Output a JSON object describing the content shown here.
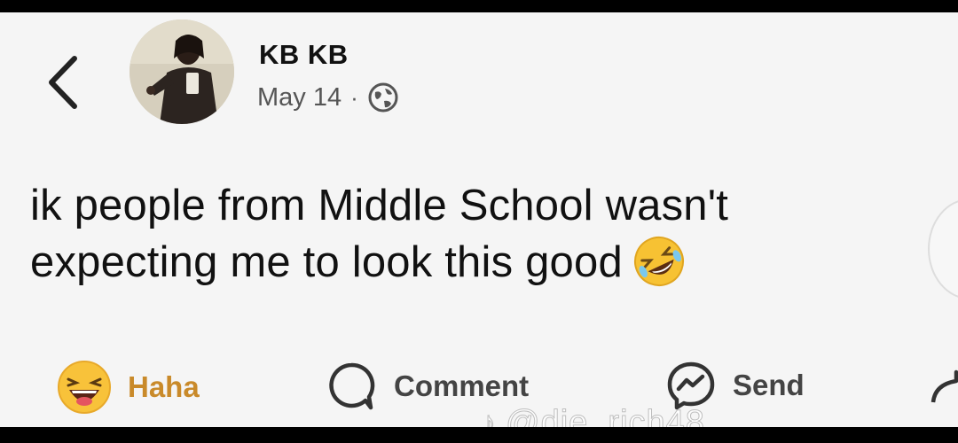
{
  "post": {
    "author": "KB KB",
    "date": "May 14",
    "separator": "·",
    "text": "ik people from Middle School wasn't expecting me to look this good",
    "emoji_icon": "rolling-on-floor-laughing-emoji"
  },
  "actions": {
    "reaction_label": "Haha",
    "comment_label": "Comment",
    "send_label": "Send"
  },
  "watermark": {
    "handle": "@die_rich48",
    "logo_icon": "tiktok-icon"
  },
  "colors": {
    "background": "#f5f5f5",
    "haha_text": "#c98a2a",
    "text": "#111111"
  }
}
